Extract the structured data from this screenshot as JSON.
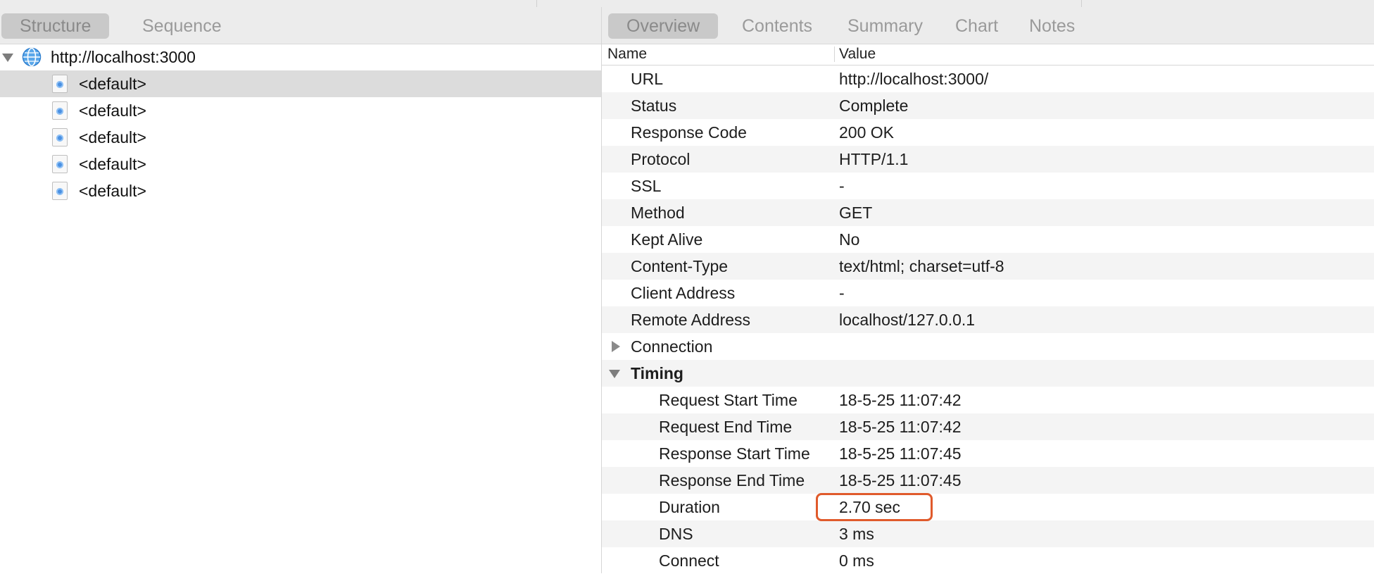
{
  "left_tabs": [
    {
      "label": "Structure"
    },
    {
      "label": "Sequence"
    }
  ],
  "tree": {
    "host": "http://localhost:3000",
    "items": [
      {
        "label": "<default>"
      },
      {
        "label": "<default>"
      },
      {
        "label": "<default>"
      },
      {
        "label": "<default>"
      },
      {
        "label": "<default>"
      }
    ]
  },
  "right_tabs": [
    {
      "label": "Overview"
    },
    {
      "label": "Contents"
    },
    {
      "label": "Summary"
    },
    {
      "label": "Chart"
    },
    {
      "label": "Notes"
    }
  ],
  "columns": {
    "name": "Name",
    "value": "Value"
  },
  "rows": [
    {
      "name": "URL",
      "value": "http://localhost:3000/"
    },
    {
      "name": "Status",
      "value": "Complete"
    },
    {
      "name": "Response Code",
      "value": "200 OK"
    },
    {
      "name": "Protocol",
      "value": "HTTP/1.1"
    },
    {
      "name": "SSL",
      "value": "-"
    },
    {
      "name": "Method",
      "value": "GET"
    },
    {
      "name": "Kept Alive",
      "value": "No"
    },
    {
      "name": "Content-Type",
      "value": "text/html; charset=utf-8"
    },
    {
      "name": "Client Address",
      "value": "-"
    },
    {
      "name": "Remote Address",
      "value": "localhost/127.0.0.1"
    },
    {
      "name": "Connection",
      "value": ""
    },
    {
      "name": "Timing",
      "value": ""
    },
    {
      "name": "Request Start Time",
      "value": "18-5-25 11:07:42"
    },
    {
      "name": "Request End Time",
      "value": "18-5-25 11:07:42"
    },
    {
      "name": "Response Start Time",
      "value": "18-5-25 11:07:45"
    },
    {
      "name": "Response End Time",
      "value": "18-5-25 11:07:45"
    },
    {
      "name": "Duration",
      "value": "2.70 sec"
    },
    {
      "name": "DNS",
      "value": "3 ms"
    },
    {
      "name": "Connect",
      "value": "0 ms"
    }
  ],
  "colors": {
    "highlight_border": "#e05a2b",
    "selected_row": "#dcdcdc",
    "active_tab": "#c9c9c9"
  },
  "icons": [
    "globe-icon",
    "document-icon",
    "disclosure-triangle-icon"
  ]
}
